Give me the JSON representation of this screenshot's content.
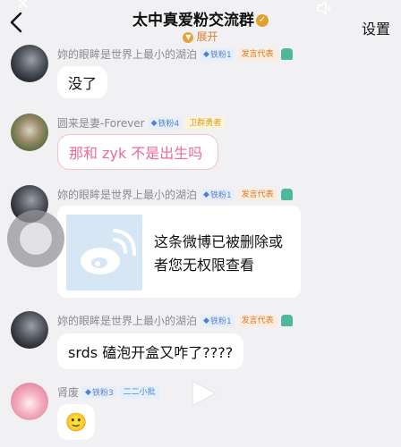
{
  "header": {
    "title": "太中真爱粉交流群",
    "expand_label": "展开",
    "settings_label": "设置"
  },
  "messages": [
    {
      "name": "妳的眼眸是世界上最小的湖泊",
      "fan_badge": "铁粉1",
      "title_badge": "发言代表",
      "text": "没了"
    },
    {
      "name": "圆来是妻-Forever",
      "fan_badge": "铁粉4",
      "title_badge": "卫群勇者",
      "text": "那和 zyk 不是出生吗"
    },
    {
      "name": "妳的眼眸是世界上最小的湖泊",
      "fan_badge": "铁粉1",
      "title_badge": "发言代表",
      "text": "这条微博已被删除或者您无权限查看"
    },
    {
      "name": "妳的眼眸是世界上最小的湖泊",
      "fan_badge": "铁粉1",
      "title_badge": "发言代表",
      "text": "srds 磕泡开盒又咋了????"
    },
    {
      "name": "肾废",
      "fan_badge": "铁粉3",
      "title_badge": "二二小批",
      "text": "🙂"
    }
  ],
  "icons": {
    "back": "chevron-left-icon",
    "verified": "verified-badge-icon",
    "sound": "speaker-icon",
    "play": "play-icon",
    "weibo": "weibo-logo-icon"
  },
  "colors": {
    "accent_orange": "#e07a2a",
    "pink_bubble_text": "#ec6a98",
    "fan_badge_blue": "#5a84c9"
  }
}
